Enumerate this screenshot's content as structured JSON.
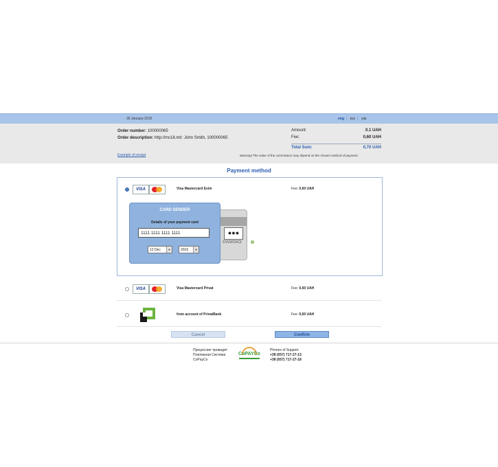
{
  "header": {
    "date": "26 January 2015",
    "languages": [
      "eng",
      "рус",
      "укр"
    ],
    "active_language": "eng"
  },
  "order": {
    "number_label": "Order number:",
    "number_value": "100000065",
    "description_label": "Order description:",
    "description_value": "http://mc18.mt/: John Smith, 100000065",
    "receipt_link": "Example of receipt"
  },
  "summary": {
    "amount_label": "Amount:",
    "amount_value": "0.1 UAH",
    "fee_label": "Fee:",
    "fee_value": "0,60 UAH",
    "total_label": "Total Sum:",
    "total_value": "0,70 UAH",
    "warning": "Warning! The value of the commission may depend on the chosen method of payment."
  },
  "payment": {
    "title": "Payment method",
    "methods": [
      {
        "name": "Visa Mastercard Exim",
        "fee_label": "Fee:",
        "fee_value": "0,60 UAH",
        "selected": true
      },
      {
        "name": "Visa Mastercard Privat",
        "fee_label": "Fee:",
        "fee_value": "0,60 UAH",
        "selected": false
      },
      {
        "name": "from account of PrivatBank",
        "fee_label": "Fee:",
        "fee_value": "0,60 UAH",
        "selected": false
      }
    ],
    "card_form": {
      "title": "CARD SENDER",
      "details_label": "Details of your payment card",
      "card_number": "1111 1111 1111 1111",
      "expiry_month": "12 Dec",
      "expiry_year": "2016",
      "cvv_value": "●●●",
      "cvv_label": "CVV2/CVC2",
      "help_icon": "question-icon"
    },
    "logos": {
      "visa": "VISA"
    }
  },
  "buttons": {
    "cancel": "Cancel",
    "confirm": "Confirm"
  },
  "footer": {
    "processed_lines": [
      "Процессинг проводит",
      "Платежная Система",
      "CoPayCo"
    ],
    "logo_text": "CoPAYCo",
    "support_title": "Phones of Support",
    "phones": [
      "+38 (057) 717-27-13",
      "+38 (057) 717-27-18"
    ]
  },
  "colors": {
    "accent": "#2a5db0",
    "topbar": "#a8c4e8",
    "card_front": "#8fb2de",
    "privat_green": "#6cb43f"
  }
}
